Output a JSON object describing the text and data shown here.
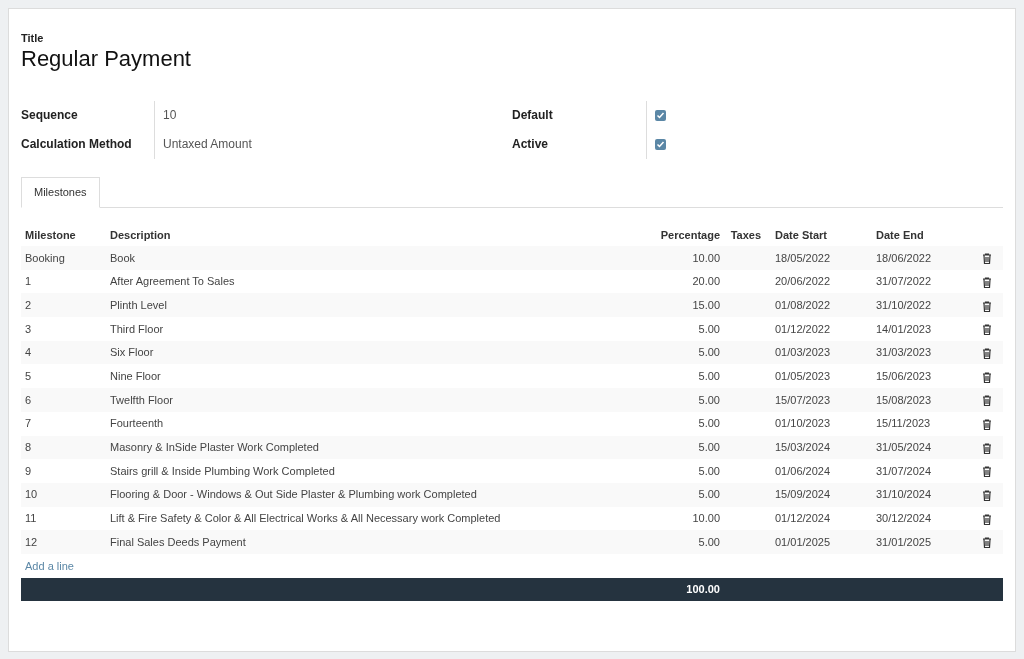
{
  "title_label": "Title",
  "title": "Regular Payment",
  "fields_left": [
    {
      "label": "Sequence",
      "value": "10"
    },
    {
      "label": "Calculation Method",
      "value": "Untaxed Amount"
    }
  ],
  "fields_right": [
    {
      "label": "Default",
      "checked": true
    },
    {
      "label": "Active",
      "checked": true
    }
  ],
  "tabs": [
    {
      "label": "Milestones",
      "selected": true
    }
  ],
  "table": {
    "columns": [
      "Milestone",
      "Description",
      "Percentage",
      "Taxes",
      "Date Start",
      "Date End"
    ],
    "rows": [
      {
        "milestone": "Booking",
        "description": "Book",
        "percentage": "10.00",
        "date_start": "18/05/2022",
        "date_end": "18/06/2022"
      },
      {
        "milestone": "1",
        "description": "After Agreement To Sales",
        "percentage": "20.00",
        "date_start": "20/06/2022",
        "date_end": "31/07/2022"
      },
      {
        "milestone": "2",
        "description": "Plinth Level",
        "percentage": "15.00",
        "date_start": "01/08/2022",
        "date_end": "31/10/2022"
      },
      {
        "milestone": "3",
        "description": "Third Floor",
        "percentage": "5.00",
        "date_start": "01/12/2022",
        "date_end": "14/01/2023"
      },
      {
        "milestone": "4",
        "description": "Six Floor",
        "percentage": "5.00",
        "date_start": "01/03/2023",
        "date_end": "31/03/2023"
      },
      {
        "milestone": "5",
        "description": "Nine Floor",
        "percentage": "5.00",
        "date_start": "01/05/2023",
        "date_end": "15/06/2023"
      },
      {
        "milestone": "6",
        "description": "Twelfth Floor",
        "percentage": "5.00",
        "date_start": "15/07/2023",
        "date_end": "15/08/2023"
      },
      {
        "milestone": "7",
        "description": "Fourteenth",
        "percentage": "5.00",
        "date_start": "01/10/2023",
        "date_end": "15/11/2023"
      },
      {
        "milestone": "8",
        "description": "Masonry & InSide Plaster Work Completed",
        "percentage": "5.00",
        "date_start": "15/03/2024",
        "date_end": "31/05/2024"
      },
      {
        "milestone": "9",
        "description": "Stairs grill & Inside Plumbing Work Completed",
        "percentage": "5.00",
        "date_start": "01/06/2024",
        "date_end": "31/07/2024"
      },
      {
        "milestone": "10",
        "description": "Flooring & Door - Windows & Out Side Plaster & Plumbing work Completed",
        "percentage": "5.00",
        "date_start": "15/09/2024",
        "date_end": "31/10/2024"
      },
      {
        "milestone": "11",
        "description": "Lift & Fire Safety & Color & All Electrical Works & All Necessary work Completed",
        "percentage": "10.00",
        "date_start": "01/12/2024",
        "date_end": "30/12/2024"
      },
      {
        "milestone": "12",
        "description": "Final Sales Deeds Payment",
        "percentage": "5.00",
        "date_start": "01/01/2025",
        "date_end": "31/01/2025"
      }
    ],
    "add_line": "Add a line",
    "total": "100.00"
  }
}
